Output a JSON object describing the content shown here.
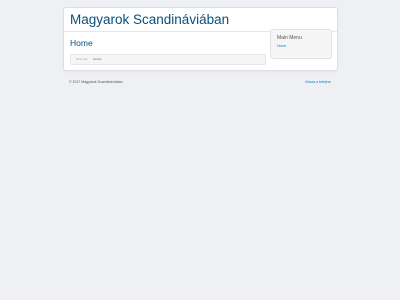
{
  "site": {
    "title": "Magyarok Scandináviában"
  },
  "main": {
    "heading": "Home"
  },
  "breadcrumb": {
    "here_label": "Itt itt van:",
    "current": "Kezdo"
  },
  "sidebar": {
    "title": "Main Menu",
    "items": [
      {
        "label": "Home"
      }
    ]
  },
  "footer": {
    "copyright": "© 2017 Magyarok Scandináviában",
    "back_to_top": "Vissza a tetejére"
  },
  "colors": {
    "accent": "#0a4f7c",
    "link": "#0088cc",
    "background": "#eef0f4"
  }
}
